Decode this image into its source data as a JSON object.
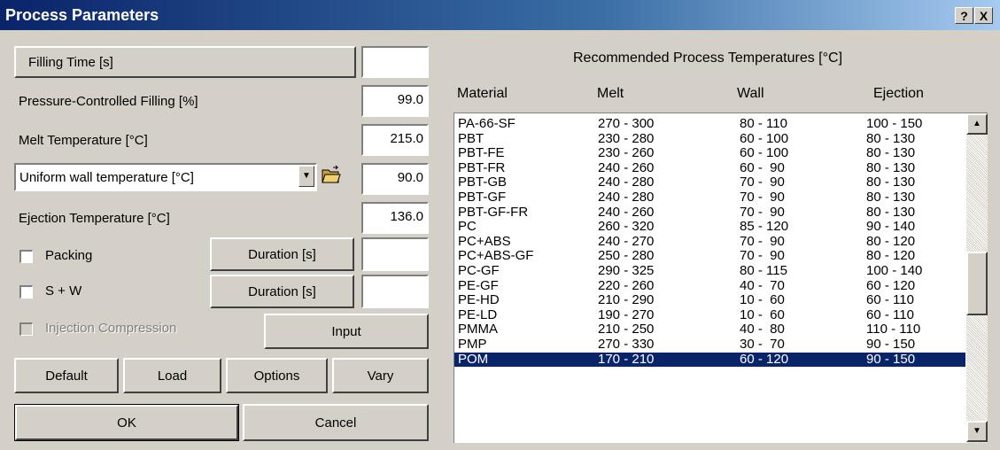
{
  "window": {
    "title": "Process Parameters",
    "help_label": "?",
    "close_label": "X"
  },
  "left": {
    "filling_time_button": "Filling Time [s]",
    "filling_time_value": "",
    "pressure_label": "Pressure-Controlled Filling [%]",
    "pressure_value": "99.0",
    "melt_label": "Melt Temperature [°C]",
    "melt_value": "215.0",
    "wall_select_value": "Uniform wall temperature [°C]",
    "wall_value": "90.0",
    "ejection_label": "Ejection Temperature [°C]",
    "ejection_value": "136.0",
    "packing_label": "Packing",
    "packing_duration_button": "Duration [s]",
    "packing_duration_value": "",
    "sw_label": "S + W",
    "sw_duration_button": "Duration [s]",
    "sw_duration_value": "",
    "injection_label": "Injection Compression",
    "input_button": "Input",
    "default_button": "Default",
    "load_button": "Load",
    "options_button": "Options",
    "vary_button": "Vary",
    "ok_button": "OK",
    "cancel_button": "Cancel"
  },
  "right": {
    "heading": "Recommended Process Temperatures [°C]",
    "columns": [
      "Material",
      "Melt",
      "Wall",
      "Ejection"
    ],
    "selected_index": 19,
    "rows": [
      [
        "PA-66-SF",
        "270 - 300",
        "80 - 110",
        "100 - 150"
      ],
      [
        "PBT",
        "230 - 280",
        "60 - 100",
        "80 - 130"
      ],
      [
        "PBT-FE",
        "230 - 260",
        "60 - 100",
        "80 - 130"
      ],
      [
        "PBT-FR",
        "240 - 260",
        "60 -  90",
        "80 - 130"
      ],
      [
        "PBT-GB",
        "240 - 280",
        "70 -  90",
        "80 - 130"
      ],
      [
        "PBT-GF",
        "240 - 280",
        "70 -  90",
        "80 - 130"
      ],
      [
        "PBT-GF-FR",
        "240 - 260",
        "70 -  90",
        "80 - 130"
      ],
      [
        "PC",
        "260 - 320",
        "85 - 120",
        "90 - 140"
      ],
      [
        "PC+ABS",
        "240 - 270",
        "70 -  90",
        "80 - 120"
      ],
      [
        "PC+ABS-GF",
        "250 - 280",
        "70 -  90",
        "80 - 120"
      ],
      [
        "PC-GF",
        "290 - 325",
        "80 - 115",
        "100 - 140"
      ],
      [
        "PE-GF",
        "220 - 260",
        "40 -  70",
        "60 - 120"
      ],
      [
        "PE-HD",
        "210 - 290",
        "10 -  60",
        "60 - 110"
      ],
      [
        "PE-LD",
        "190 - 270",
        "10 -  60",
        "60 - 110"
      ],
      [
        "PMMA",
        "210 - 250",
        "40 -  80",
        "110 - 110"
      ],
      [
        "PMP",
        "270 - 330",
        "30 -  70",
        "90 - 150"
      ],
      [
        "POM",
        "170 - 210",
        "60 - 120",
        "90 - 150"
      ]
    ]
  },
  "icons": [
    "help-icon",
    "close-icon",
    "dropdown-arrow-icon",
    "open-folder-icon",
    "scroll-up-icon",
    "scroll-down-icon"
  ]
}
